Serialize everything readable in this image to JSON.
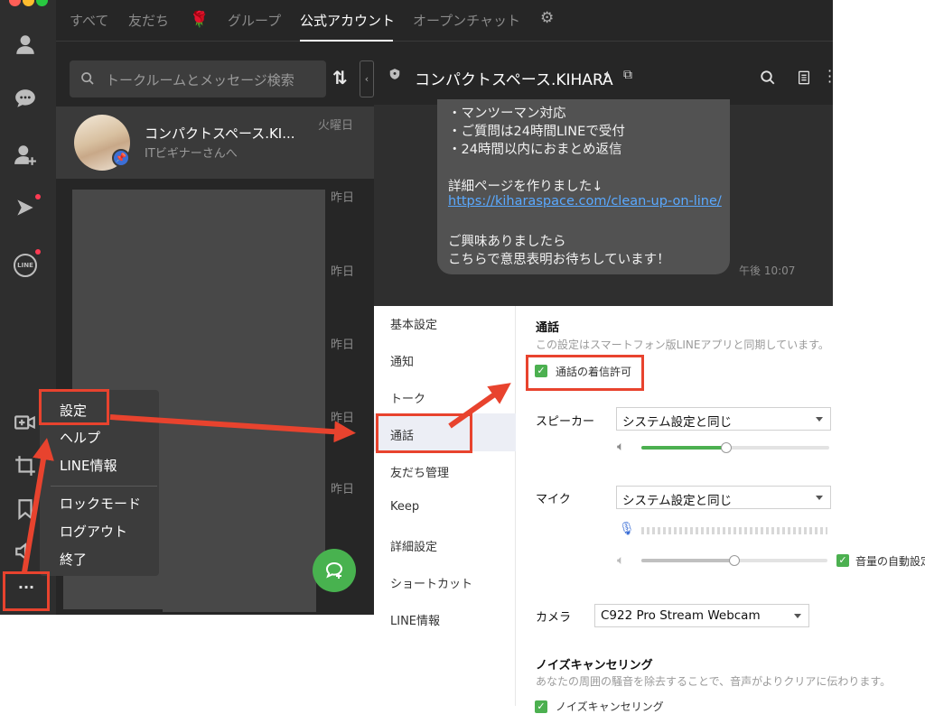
{
  "window": {
    "dot_colors": [
      "#ff5f57",
      "#febc2e",
      "#28c840"
    ]
  },
  "rail": {
    "icons": [
      "person-icon",
      "chat-bubble-icon",
      "add-friend-icon",
      "play-icon",
      "line-badge-icon",
      "video-call-icon",
      "crop-icon",
      "bookmark-icon",
      "speaker-icon"
    ],
    "line_badge": "LINE",
    "more": "···"
  },
  "tabs": [
    "すべて",
    "友だち",
    "グループ",
    "公式アカウント",
    "オープンチャット"
  ],
  "search": {
    "placeholder": "トークルームとメッセージ検索"
  },
  "chats": [
    {
      "name": "コンパクトスペース.KI...",
      "preview": "ITビギナーさんへ",
      "date": "火曜日"
    },
    {
      "date": "昨日"
    },
    {
      "date": "昨日"
    },
    {
      "date": "昨日"
    },
    {
      "date": "昨日"
    },
    {
      "date": "昨日"
    }
  ],
  "chat": {
    "title": "コンパクトスペース.KIHARA",
    "lines": [
      "・マンツーマン対応",
      "・ご質問は24時間LINEで受付",
      "・24時間以内におまとめ返信",
      "",
      "詳細ページを作りました↓",
      "https://kiharaspace.com/clean-up-on-line/",
      "",
      "ご興味ありましたら",
      "こちらで意思表明お待ちしています！"
    ],
    "time": "午後 10:07"
  },
  "menu": {
    "items": [
      "設定",
      "ヘルプ",
      "LINE情報",
      "ロックモード",
      "ログアウト",
      "終了"
    ]
  },
  "settings": {
    "nav": [
      "基本設定",
      "通知",
      "トーク",
      "通話",
      "友だち管理",
      "Keep",
      "詳細設定",
      "ショートカット",
      "LINE情報"
    ],
    "selected": "通話",
    "section_title": "通話",
    "section_desc": "この設定はスマートフォン版LINEアプリと同期しています。",
    "allow_calls": "通話の着信許可",
    "speaker_label": "スピーカー",
    "speaker_value": "システム設定と同じ",
    "speaker_level": 0.45,
    "mic_label": "マイク",
    "mic_value": "システム設定と同じ",
    "mic_level": 0.5,
    "auto_volume": "音量の自動設定",
    "camera_label": "カメラ",
    "camera_value": "C922 Pro Stream Webcam",
    "noise_title": "ノイズキャンセリング",
    "noise_desc": "あなたの周囲の騒音を除去することで、音声がよりクリアに伝わります。",
    "noise_option": "ノイズキャンセリング"
  },
  "colors": {
    "accent_red": "#e8432e",
    "line_green": "#48b24f",
    "link": "#5aa9ff"
  }
}
